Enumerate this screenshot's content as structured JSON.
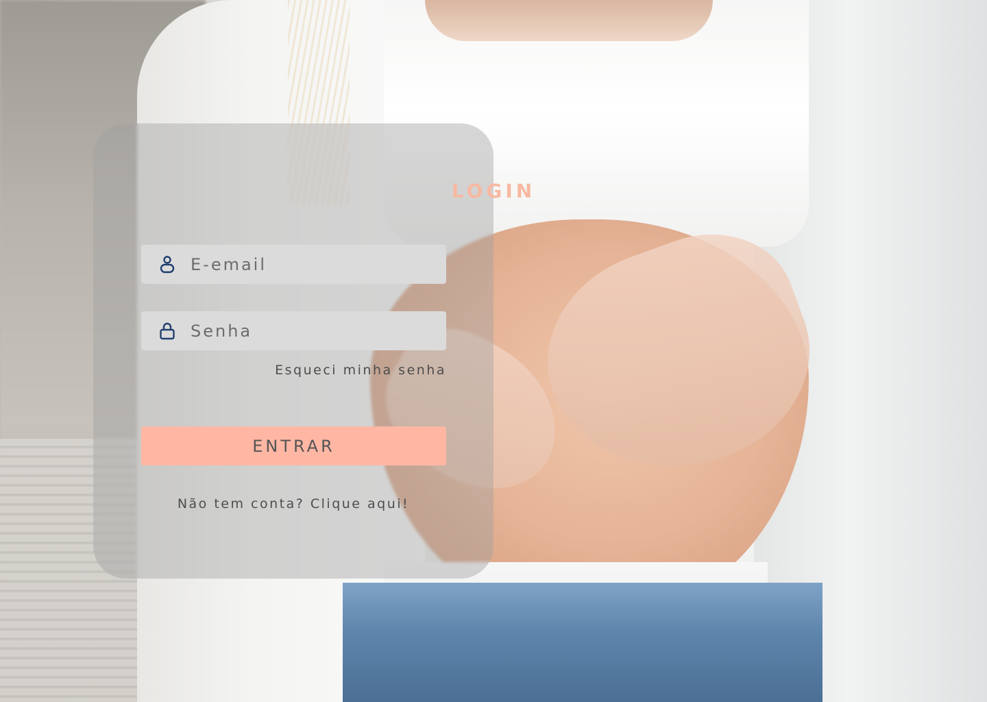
{
  "login": {
    "title": "LOGIN",
    "email_placeholder": "E-email",
    "password_placeholder": "Senha",
    "forgot_password_label": "Esqueci minha senha",
    "submit_label": "ENTRAR",
    "signup_prompt": "Não tem conta? Clique aqui!"
  },
  "icons": {
    "email": "user-icon",
    "password": "lock-icon"
  },
  "colors": {
    "accent": "#ffb7a4",
    "title": "#f7b9a1",
    "icon": "#1f3f6e",
    "field_background": "#dcdbdb"
  }
}
